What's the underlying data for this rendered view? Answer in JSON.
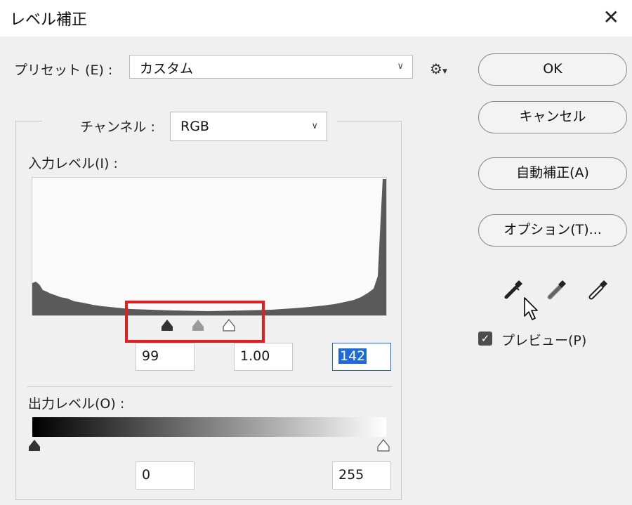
{
  "window": {
    "title": "レベル補正",
    "close_glyph": "✕"
  },
  "preset": {
    "label": "プリセット (E) :",
    "value": "カスタム"
  },
  "channel": {
    "label": "チャンネル :",
    "value": "RGB"
  },
  "input_levels": {
    "label": "入力レベル(I) :",
    "black": "99",
    "gamma": "1.00",
    "white": "142"
  },
  "output_levels": {
    "label": "出力レベル(O) :",
    "black": "0",
    "white": "255"
  },
  "buttons": {
    "ok": "OK",
    "cancel": "キャンセル",
    "auto": "自動補正(A)",
    "options": "オプション(T)..."
  },
  "preview": {
    "label": "プレビュー(P)",
    "checked": true
  },
  "colors": {
    "highlight_box": "#e02020",
    "selection": "#1e6ad6",
    "histogram_fill": "#5a5a5a"
  },
  "icons": [
    "close-icon",
    "gear-icon",
    "chevron-down-icon",
    "black-eyedropper-icon",
    "gray-eyedropper-icon",
    "white-eyedropper-icon",
    "checkbox-checked-icon",
    "mouse-cursor-icon"
  ]
}
